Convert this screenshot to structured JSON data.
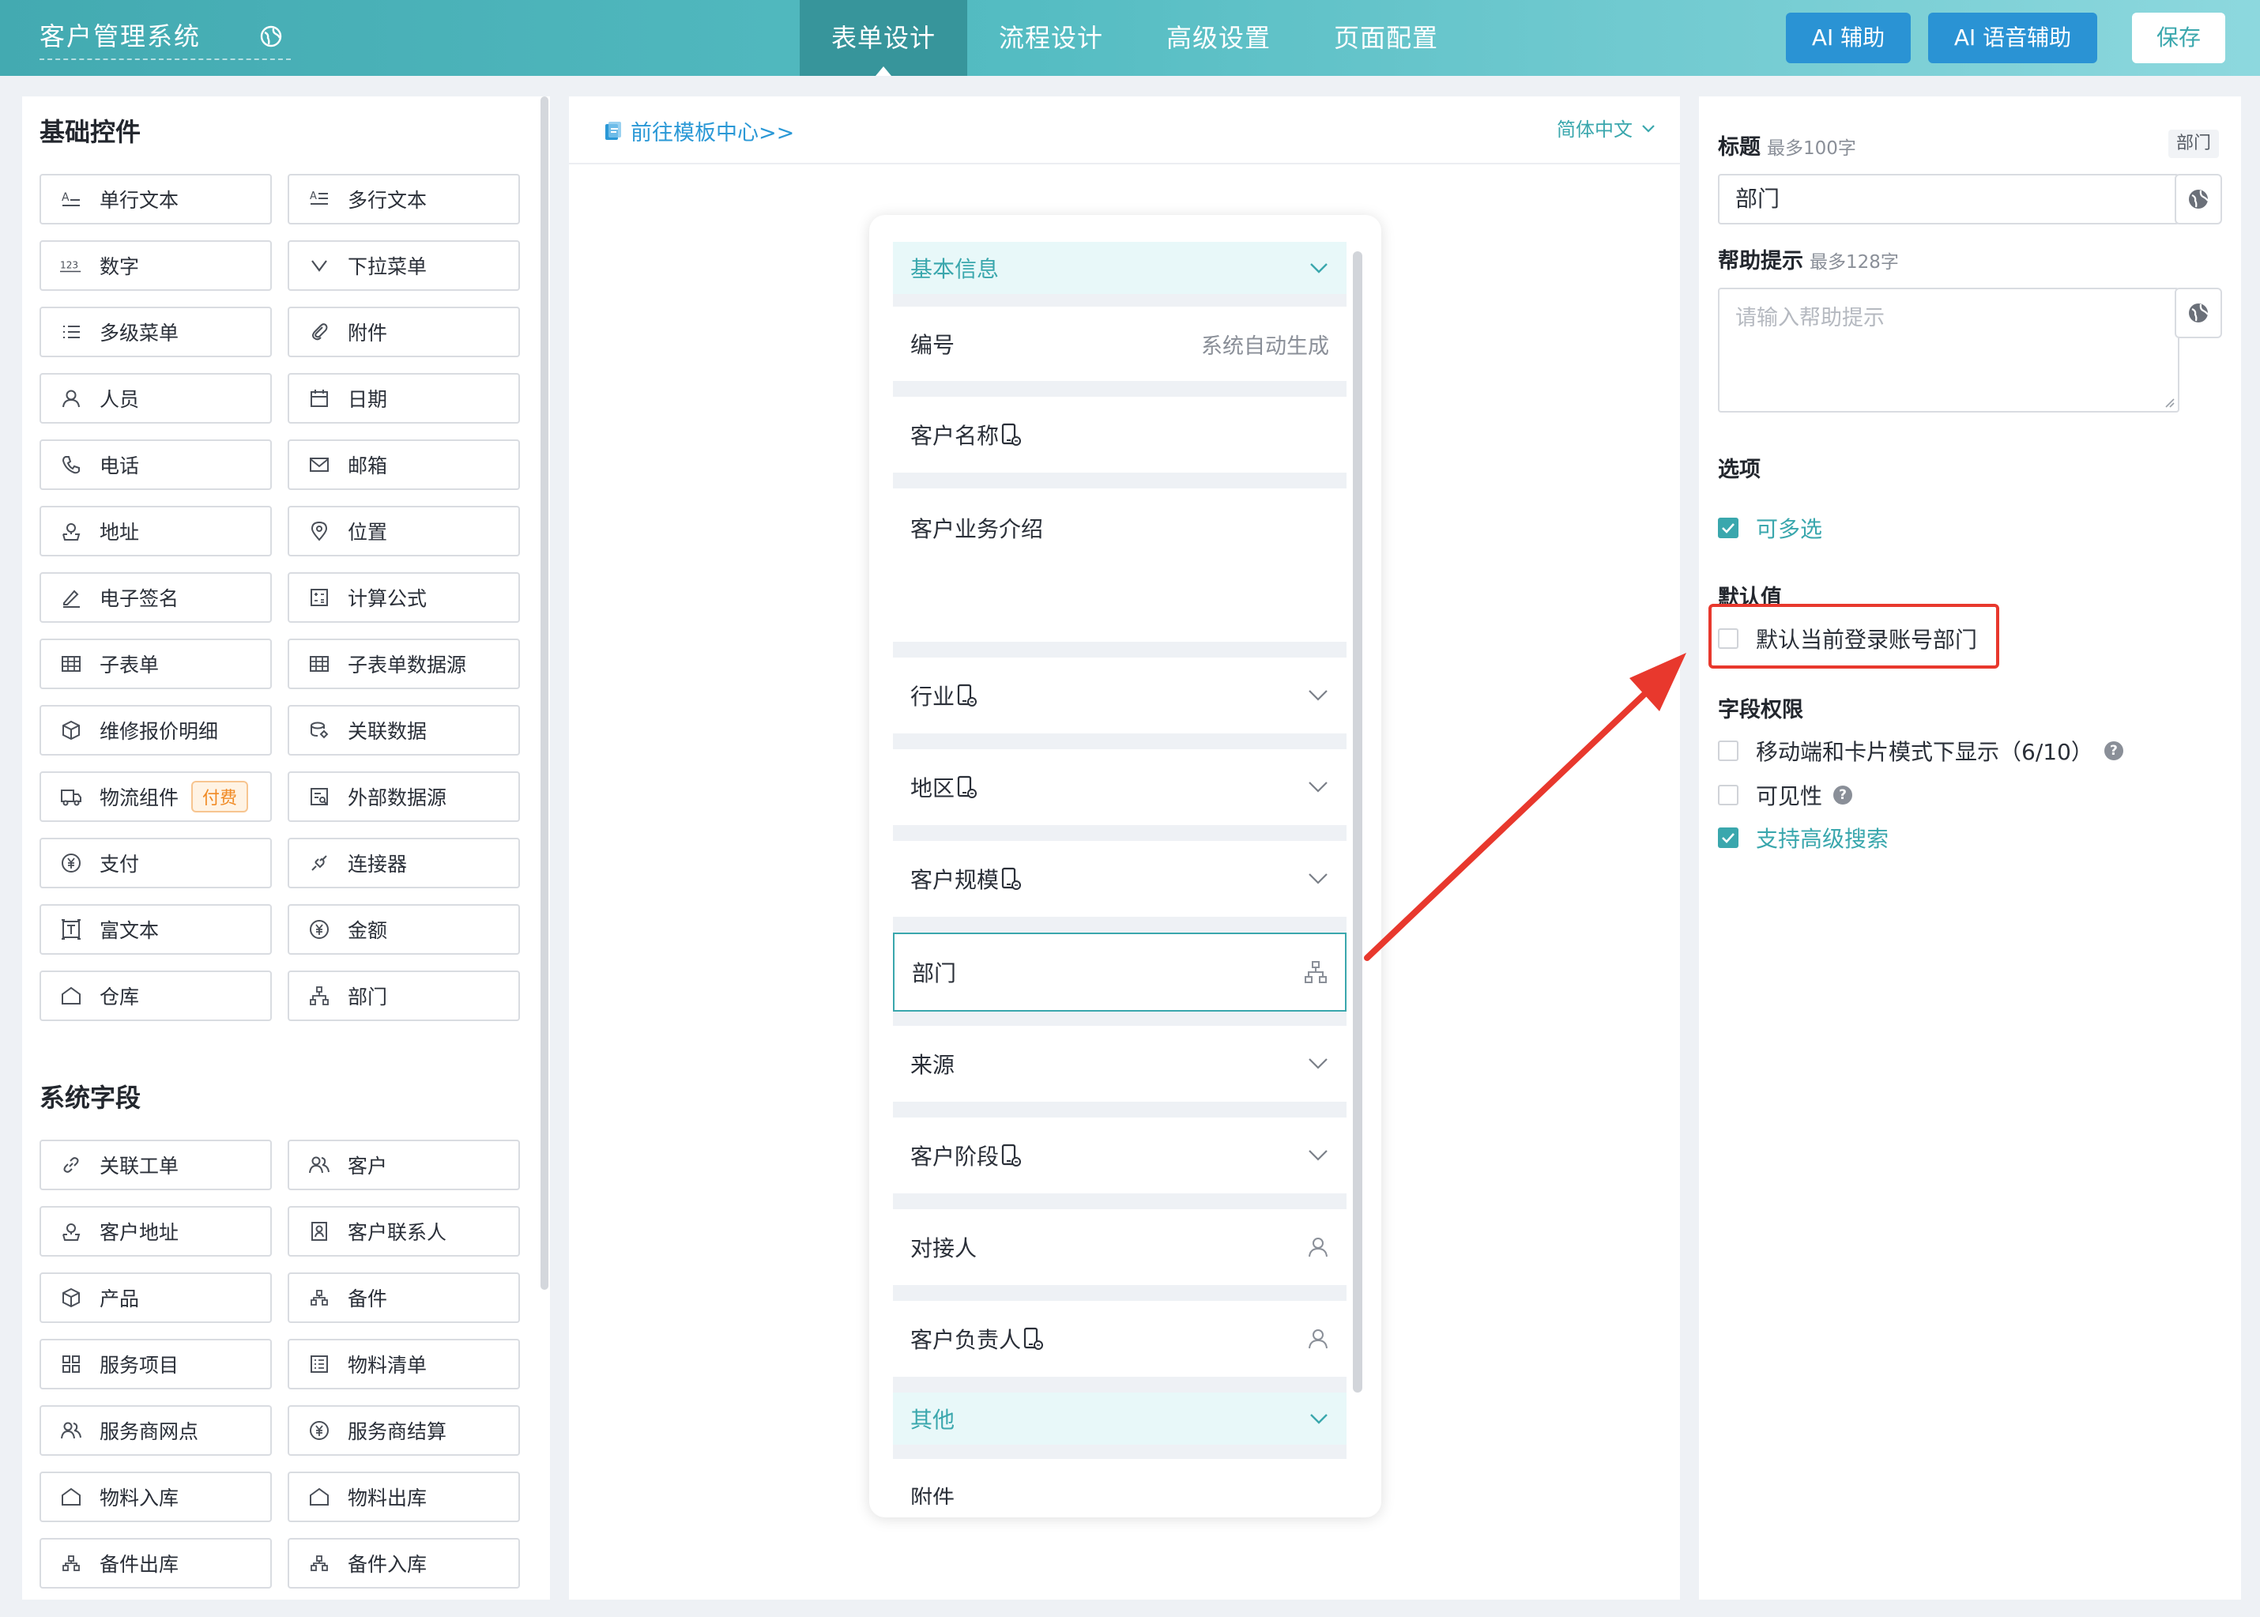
{
  "app": {
    "title": "客户管理系统",
    "globe_icon": "globe-icon"
  },
  "nav": {
    "tabs": [
      {
        "label": "表单设计",
        "active": true
      },
      {
        "label": "流程设计",
        "active": false
      },
      {
        "label": "高级设置",
        "active": false
      },
      {
        "label": "页面配置",
        "active": false
      }
    ],
    "ai_assist": "AI 辅助",
    "ai_voice": "AI 语音辅助",
    "save": "保存"
  },
  "left": {
    "basic_title": "基础控件",
    "basic": [
      {
        "label": "单行文本",
        "icon": "single-line-text-icon"
      },
      {
        "label": "多行文本",
        "icon": "multi-line-text-icon"
      },
      {
        "label": "数字",
        "icon": "number-icon"
      },
      {
        "label": "下拉菜单",
        "icon": "dropdown-icon"
      },
      {
        "label": "多级菜单",
        "icon": "multi-level-menu-icon"
      },
      {
        "label": "附件",
        "icon": "attachment-icon"
      },
      {
        "label": "人员",
        "icon": "person-icon"
      },
      {
        "label": "日期",
        "icon": "calendar-icon"
      },
      {
        "label": "电话",
        "icon": "phone-icon"
      },
      {
        "label": "邮箱",
        "icon": "mail-icon"
      },
      {
        "label": "地址",
        "icon": "address-icon"
      },
      {
        "label": "位置",
        "icon": "location-pin-icon"
      },
      {
        "label": "电子签名",
        "icon": "signature-icon"
      },
      {
        "label": "计算公式",
        "icon": "calculator-icon"
      },
      {
        "label": "子表单",
        "icon": "table-icon"
      },
      {
        "label": "子表单数据源",
        "icon": "table-icon"
      },
      {
        "label": "维修报价明细",
        "icon": "box-icon"
      },
      {
        "label": "关联数据",
        "icon": "link-data-icon"
      },
      {
        "label": "物流组件",
        "icon": "truck-icon",
        "badge": "付费"
      },
      {
        "label": "外部数据源",
        "icon": "external-data-icon"
      },
      {
        "label": "支付",
        "icon": "payment-icon"
      },
      {
        "label": "连接器",
        "icon": "connector-icon"
      },
      {
        "label": "富文本",
        "icon": "rich-text-icon"
      },
      {
        "label": "金额",
        "icon": "yuan-icon"
      },
      {
        "label": "仓库",
        "icon": "warehouse-icon"
      },
      {
        "label": "部门",
        "icon": "org-chart-icon"
      }
    ],
    "system_title": "系统字段",
    "system": [
      {
        "label": "关联工单",
        "icon": "link-icon"
      },
      {
        "label": "客户",
        "icon": "customers-icon"
      },
      {
        "label": "客户地址",
        "icon": "address-icon"
      },
      {
        "label": "客户联系人",
        "icon": "contact-icon"
      },
      {
        "label": "产品",
        "icon": "box-icon"
      },
      {
        "label": "备件",
        "icon": "parts-icon"
      },
      {
        "label": "服务项目",
        "icon": "grid-icon"
      },
      {
        "label": "物料清单",
        "icon": "list-icon"
      },
      {
        "label": "服务商网点",
        "icon": "customers-icon"
      },
      {
        "label": "服务商结算",
        "icon": "yuan-icon"
      },
      {
        "label": "物料入库",
        "icon": "warehouse-icon"
      },
      {
        "label": "物料出库",
        "icon": "warehouse-icon"
      },
      {
        "label": "备件出库",
        "icon": "parts-icon"
      },
      {
        "label": "备件入库",
        "icon": "parts-icon"
      }
    ]
  },
  "center": {
    "template_link": "前往模板中心>>",
    "language": "简体中文",
    "groups": [
      "基本信息",
      "其他"
    ],
    "fields": [
      {
        "label": "编号",
        "right": "系统自动生成"
      },
      {
        "label": "客户名称",
        "mobile": true
      },
      {
        "label": "客户业务介绍"
      },
      {
        "label": "行业",
        "mobile": true
      },
      {
        "label": "地区",
        "mobile": true
      },
      {
        "label": "客户规模",
        "mobile": true
      },
      {
        "label": "部门"
      },
      {
        "label": "来源"
      },
      {
        "label": "客户阶段",
        "mobile": true
      },
      {
        "label": "对接人"
      },
      {
        "label": "客户负责人",
        "mobile": true
      },
      {
        "label": "附件"
      }
    ]
  },
  "props": {
    "title_label": "标题",
    "title_hint": "最多100字",
    "field_tag": "部门",
    "title_value": "部门",
    "help_label": "帮助提示",
    "help_hint": "最多128字",
    "help_placeholder": "请输入帮助提示",
    "options_label": "选项",
    "multi_select": {
      "label": "可多选",
      "checked": true
    },
    "default_label": "默认值",
    "default_dept": {
      "label": "默认当前登录账号部门",
      "checked": false
    },
    "perm_label": "字段权限",
    "perm_mobile": {
      "label": "移动端和卡片模式下显示（6/10）",
      "checked": false
    },
    "perm_visible": {
      "label": "可见性",
      "checked": false
    },
    "perm_search": {
      "label": "支持高级搜索",
      "checked": true
    }
  },
  "colors": {
    "primary": "#3aa7ad",
    "ai_button": "#2a93d4",
    "annotation": "#e8382d"
  }
}
